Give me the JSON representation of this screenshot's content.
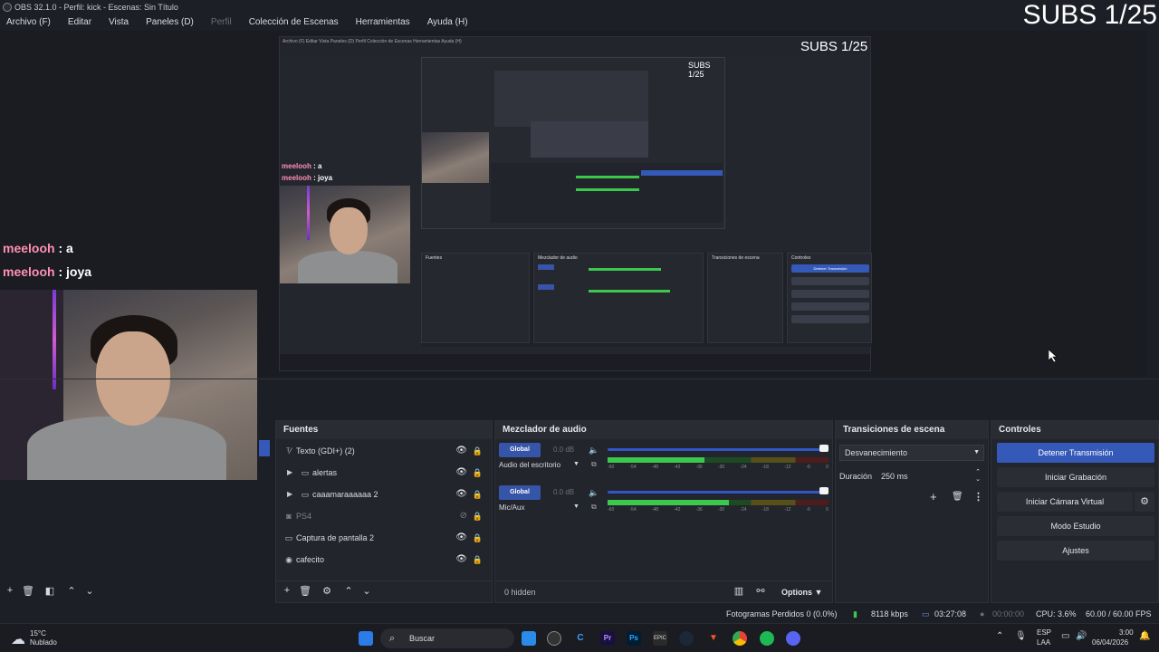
{
  "window": {
    "title": "OBS 32.1.0 - Perfil: kick - Escenas: Sin Título"
  },
  "menu": [
    "Archivo (F)",
    "Editar",
    "Vista",
    "Paneles (D)",
    "Perfil",
    "Colección de Escenas",
    "Herramientas",
    "Ayuda (H)"
  ],
  "overlay": {
    "subs": "SUBS 1/25",
    "chat": [
      {
        "user": "meelooh",
        "sep": " : ",
        "msg": "a"
      },
      {
        "user": "meelooh",
        "sep": " : ",
        "msg": "joya"
      }
    ]
  },
  "sources": {
    "title": "Fuentes",
    "items": [
      {
        "label": "Texto (GDI+) (2)",
        "icon": "text-icon",
        "visible": true,
        "group": false
      },
      {
        "label": "alertas",
        "icon": "folder-icon",
        "visible": true,
        "group": true
      },
      {
        "label": "caaamaraaaaaa 2",
        "icon": "folder-icon",
        "visible": true,
        "group": true
      },
      {
        "label": "PS4",
        "icon": "camera-icon",
        "visible": false,
        "group": false
      },
      {
        "label": "Captura de pantalla 2",
        "icon": "monitor-icon",
        "visible": true,
        "group": false
      },
      {
        "label": "cafecito",
        "icon": "globe-icon",
        "visible": true,
        "group": false
      }
    ]
  },
  "mixer": {
    "title": "Mezclador de audio",
    "channels": [
      {
        "name": "Audio del escritorio",
        "global": "Global",
        "db": "0.0 dB",
        "level": 0.44
      },
      {
        "name": "Mic/Aux",
        "global": "Global",
        "db": "0.0 dB",
        "level": 0.55
      }
    ],
    "scale": [
      "-60",
      "-54",
      "-48",
      "-42",
      "-36",
      "-30",
      "-24",
      "-18",
      "-12",
      "-6",
      "0"
    ],
    "hidden": "0 hidden",
    "options": "Options"
  },
  "transitions": {
    "title": "Transiciones de escena",
    "selected": "Desvanecimiento",
    "duration_label": "Duración",
    "duration": "250 ms"
  },
  "controls": {
    "title": "Controles",
    "stop_stream": "Detener Transmisión",
    "start_record": "Iniciar Grabación",
    "virtual_cam": "Iniciar Cámara Virtual",
    "studio_mode": "Modo Estudio",
    "settings": "Ajustes"
  },
  "status": {
    "dropped": "Fotogramas Perdidos 0 (0.0%)",
    "bitrate": "8118 kbps",
    "stream_time": "03:27:08",
    "rec_time": "00:00:00",
    "cpu": "CPU: 3.6%",
    "fps": "60.00 / 60.00 FPS"
  },
  "taskbar": {
    "weather_temp": "15°C",
    "weather_desc": "Nublado",
    "search": "Buscar",
    "lang": "ESP",
    "lang2": "LAA",
    "time": "3:00",
    "date": "06/04/2026"
  },
  "mini": {
    "menu": "Archivo (F)  Editar  Vista  Paneles (D)  Perfil  Colección de Escenas  Herramientas  Ayuda (H)",
    "sources": "Fuentes",
    "mixer": "Mezclador de audio",
    "transitions": "Transiciones de escena",
    "controls": "Controles",
    "stop": "Detener Transmisión"
  }
}
